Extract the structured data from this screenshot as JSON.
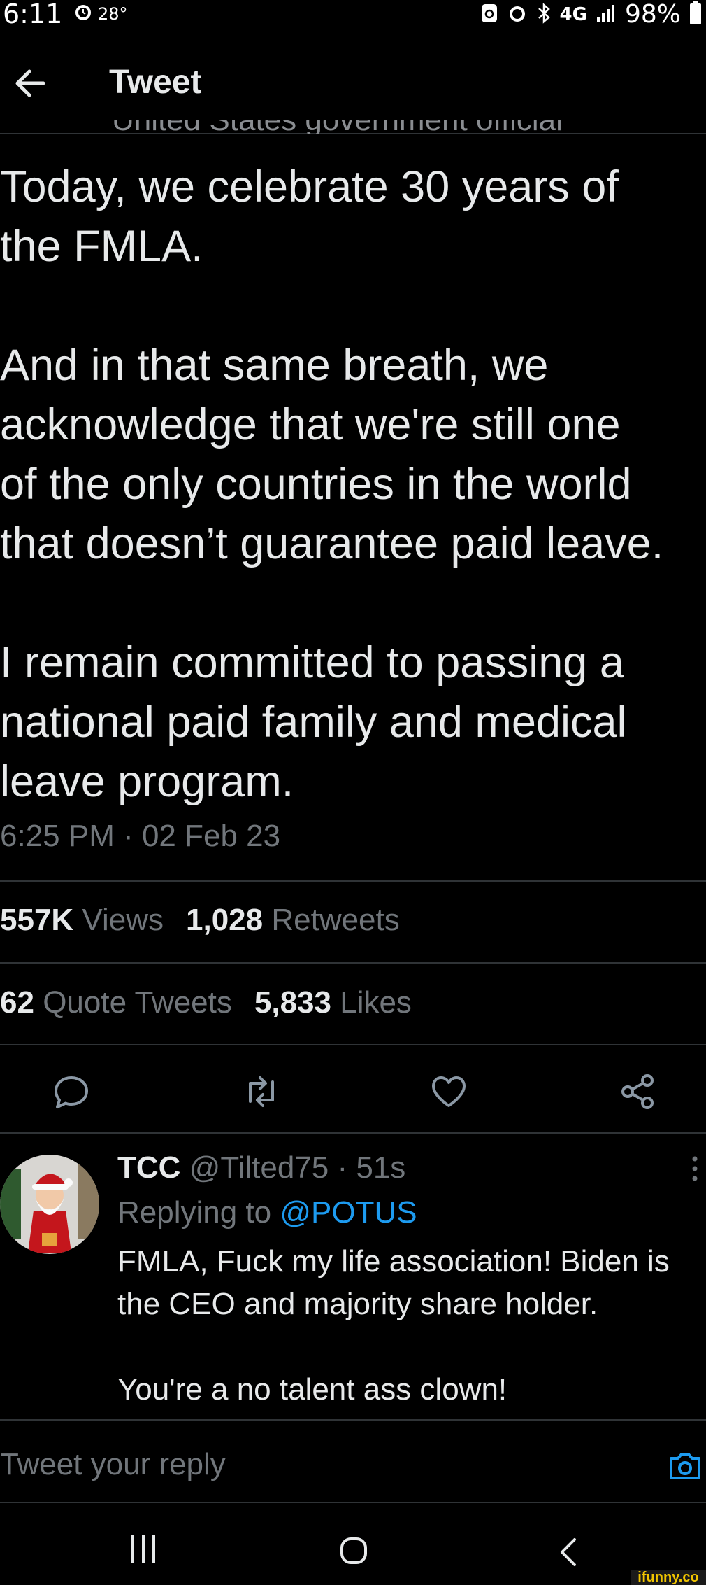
{
  "status_bar": {
    "time": "6:11",
    "temperature": "28°",
    "network": "4G",
    "battery": "98%"
  },
  "header": {
    "title": "Tweet"
  },
  "author_badge_peek": "United States government official",
  "tweet": {
    "text": "Today, we celebrate 30 years of\nthe FMLA.\n\nAnd in that same breath, we\nacknowledge that we're still one\nof the only countries in the world\nthat doesn’t guarantee paid leave.\n\nI remain committed to passing a\nnational paid family and medical\nleave program.",
    "timestamp": "6:25 PM · 02 Feb 23"
  },
  "stats": {
    "views_count": "557K",
    "views_label": "Views",
    "retweets_count": "1,028",
    "retweets_label": "Retweets",
    "quotes_count": "62",
    "quotes_label": "Quote Tweets",
    "likes_count": "5,833",
    "likes_label": "Likes"
  },
  "actions": {
    "reply": "reply-icon",
    "retweet": "retweet-icon",
    "like": "heart-icon",
    "share": "share-icon"
  },
  "reply": {
    "name": "TCC",
    "handle": "@Tilted75",
    "time": "· 51s",
    "replying_prefix": "Replying to",
    "replying_to": "@POTUS",
    "text": "FMLA, Fuck my life association! Biden is\nthe CEO and majority share holder.\n\nYou're a no talent ass clown!"
  },
  "compose": {
    "placeholder": "Tweet your reply"
  },
  "watermark": "ifunny.co",
  "colors": {
    "background": "#000000",
    "text": "#e7e9ea",
    "secondary": "#71767b",
    "accent": "#1d9bf0",
    "divider": "#2f3336"
  }
}
